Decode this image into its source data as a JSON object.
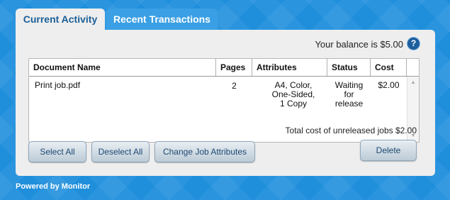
{
  "tabs": {
    "current": "Current Activity",
    "recent": "Recent Transactions"
  },
  "balance": {
    "text": "Your balance is $5.00",
    "help": "?"
  },
  "table": {
    "headers": {
      "doc": "Document Name",
      "pages": "Pages",
      "attributes": "Attributes",
      "status": "Status",
      "cost": "Cost"
    },
    "rows": [
      {
        "doc": "Print job.pdf",
        "pages": "2",
        "attributes": "A4, Color,\nOne-Sided,\n1 Copy",
        "status": "Waiting\nfor\nrelease",
        "cost": "$2.00"
      }
    ]
  },
  "total": "Total cost of unreleased jobs $2.00",
  "buttons": {
    "select_all": "Select All",
    "deselect_all": "Deselect All",
    "change_attributes": "Change Job Attributes",
    "delete": "Delete"
  },
  "footer": "Powered by Monitor",
  "colors": {
    "background": "#1f8fdc",
    "active_tab_text": "#1a5e97",
    "button_text": "#1c4872"
  },
  "icons": {
    "help": "help-circle-icon",
    "scroll_up": "scroll-up-arrow-icon",
    "scroll_down": "scroll-down-arrow-icon"
  }
}
